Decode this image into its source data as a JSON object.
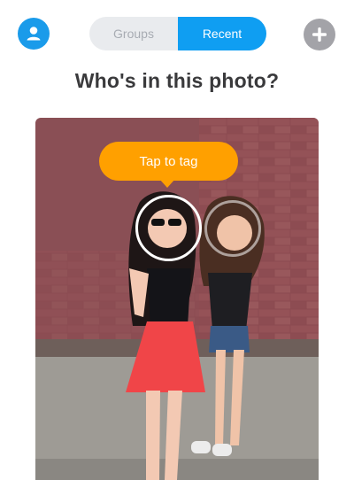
{
  "header": {
    "profile_icon": "person-icon",
    "add_icon": "plus-icon",
    "tabs": [
      {
        "label": "Groups",
        "active": false
      },
      {
        "label": "Recent",
        "active": true
      }
    ]
  },
  "main": {
    "title": "Who's in this photo?",
    "photo": {
      "tooltip": "Tap to tag"
    }
  },
  "colors": {
    "accent_blue": "#0f9ef2",
    "tooltip_orange": "#ffa000",
    "add_gray": "#a3a3a8"
  }
}
